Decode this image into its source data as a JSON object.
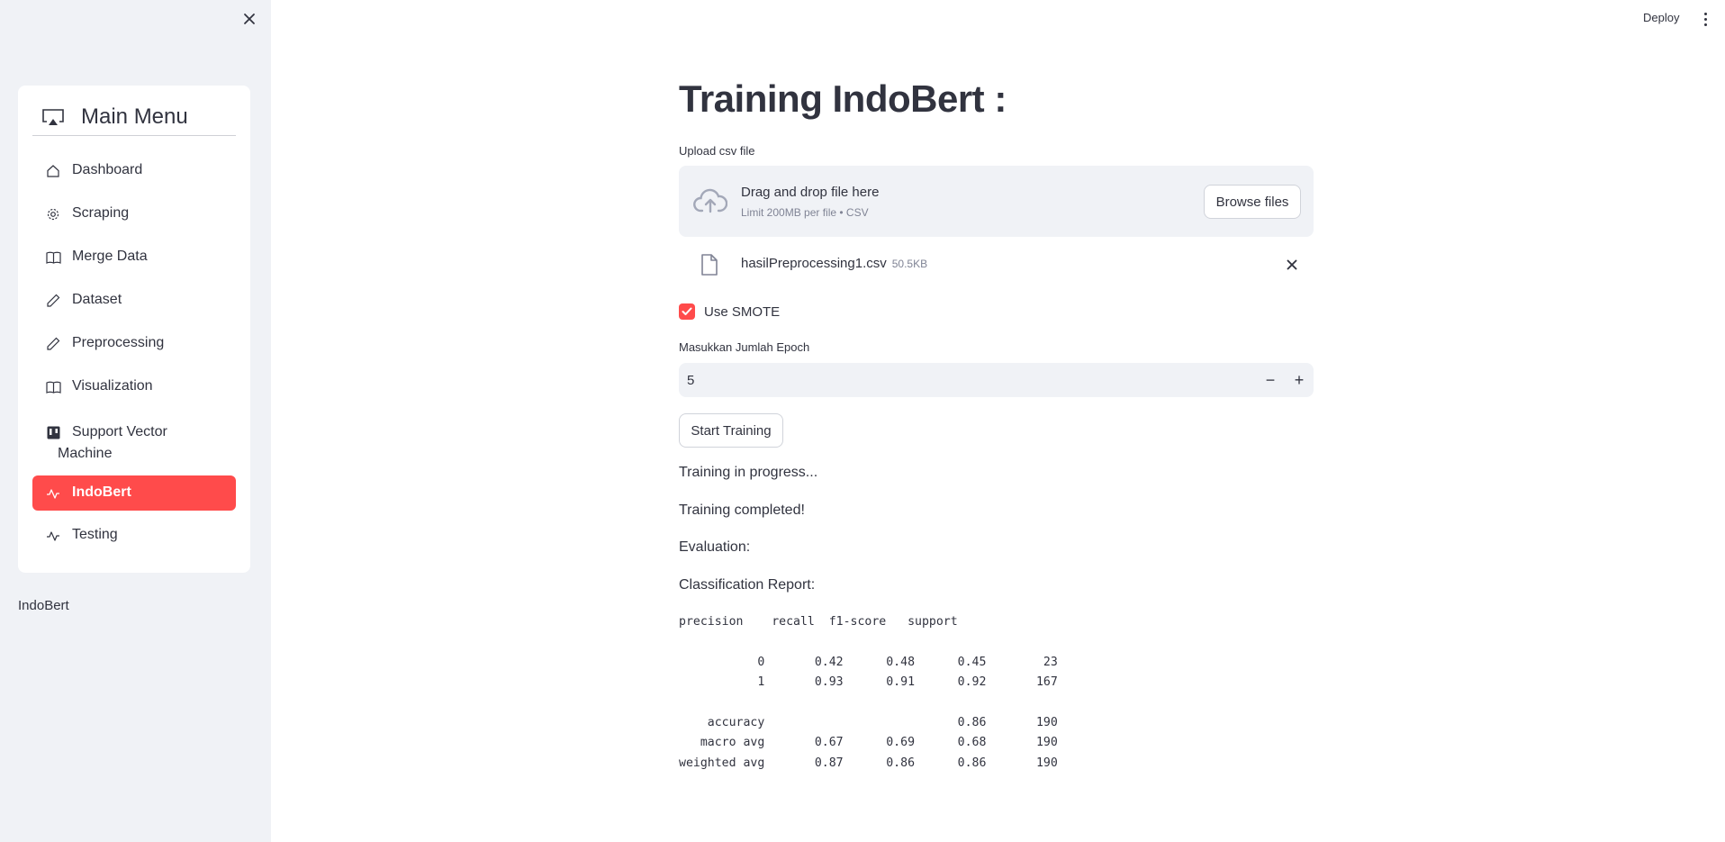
{
  "sidebar": {
    "menu_title": "Main Menu",
    "items": [
      {
        "label": "Dashboard",
        "icon": "house-icon"
      },
      {
        "label": "Scraping",
        "icon": "gear-icon"
      },
      {
        "label": "Merge Data",
        "icon": "book-icon"
      },
      {
        "label": "Dataset",
        "icon": "pencil-icon"
      },
      {
        "label": "Preprocessing",
        "icon": "pencil-icon"
      },
      {
        "label": "Visualization",
        "icon": "book-icon"
      },
      {
        "label": "Support Vector Machine",
        "icon": "kanban-icon"
      },
      {
        "label": "IndoBert",
        "icon": "activity-icon",
        "active": true
      },
      {
        "label": "Testing",
        "icon": "activity-icon"
      }
    ],
    "footer": "IndoBert"
  },
  "header": {
    "deploy_label": "Deploy"
  },
  "main": {
    "title": "Training IndoBert :",
    "upload": {
      "label": "Upload csv file",
      "drop_text": "Drag and drop file here",
      "limit_text": "Limit 200MB per file • CSV",
      "browse_label": "Browse files",
      "file_name": "hasilPreprocessing1.csv",
      "file_size": "50.5KB"
    },
    "smote": {
      "label": "Use SMOTE",
      "checked": true
    },
    "epoch": {
      "label": "Masukkan Jumlah Epoch",
      "value": "5",
      "minus": "−",
      "plus": "+"
    },
    "start_button": "Start Training",
    "status_progress": "Training in progress...",
    "status_completed": "Training completed!",
    "evaluation_label": "Evaluation:",
    "report_label": "Classification Report:",
    "report_text": "precision    recall  f1-score   support\n\n           0       0.42      0.48      0.45        23\n           1       0.93      0.91      0.92       167\n\n    accuracy                           0.86       190\n   macro avg       0.67      0.69      0.68       190\nweighted avg       0.87      0.86      0.86       190"
  },
  "colors": {
    "accent": "#ff4b4b",
    "sidebar_bg": "#f0f2f6",
    "text": "#31333f",
    "muted": "#808495"
  }
}
